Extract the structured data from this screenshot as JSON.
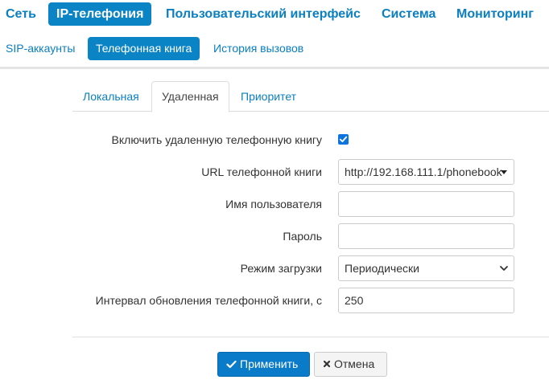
{
  "top_nav": {
    "items": [
      {
        "label": "Сеть"
      },
      {
        "label": "IP-телефония"
      },
      {
        "label": "Пользовательский интерфейс"
      },
      {
        "label": "Система"
      },
      {
        "label": "Мониторинг"
      }
    ],
    "active_index": 1
  },
  "sub_nav": {
    "items": [
      {
        "label": "SIP-аккаунты"
      },
      {
        "label": "Телефонная книга"
      },
      {
        "label": "История вызовов"
      }
    ],
    "active_index": 1
  },
  "tabs": {
    "items": [
      {
        "label": "Локальная"
      },
      {
        "label": "Удаленная"
      },
      {
        "label": "Приоритет"
      }
    ],
    "active_index": 1
  },
  "form": {
    "enable_remote": {
      "label": "Включить удаленную телефонную книгу",
      "checked": true
    },
    "url": {
      "label": "URL телефонной книги",
      "value": "http://192.168.111.1/phonebook"
    },
    "username": {
      "label": "Имя пользователя",
      "value": ""
    },
    "password": {
      "label": "Пароль",
      "value": ""
    },
    "load_mode": {
      "label": "Режим загрузки",
      "value": "Периодически"
    },
    "update_interval": {
      "label": "Интервал обновления телефонной книги, с",
      "value": "250"
    }
  },
  "buttons": {
    "apply": {
      "label": "Применить",
      "icon": "check-icon"
    },
    "cancel": {
      "label": "Отмена",
      "icon": "close-icon"
    }
  },
  "colors": {
    "accent": "#0b84c6",
    "link": "#0a7fc2",
    "checkbox": "#0b74de"
  }
}
